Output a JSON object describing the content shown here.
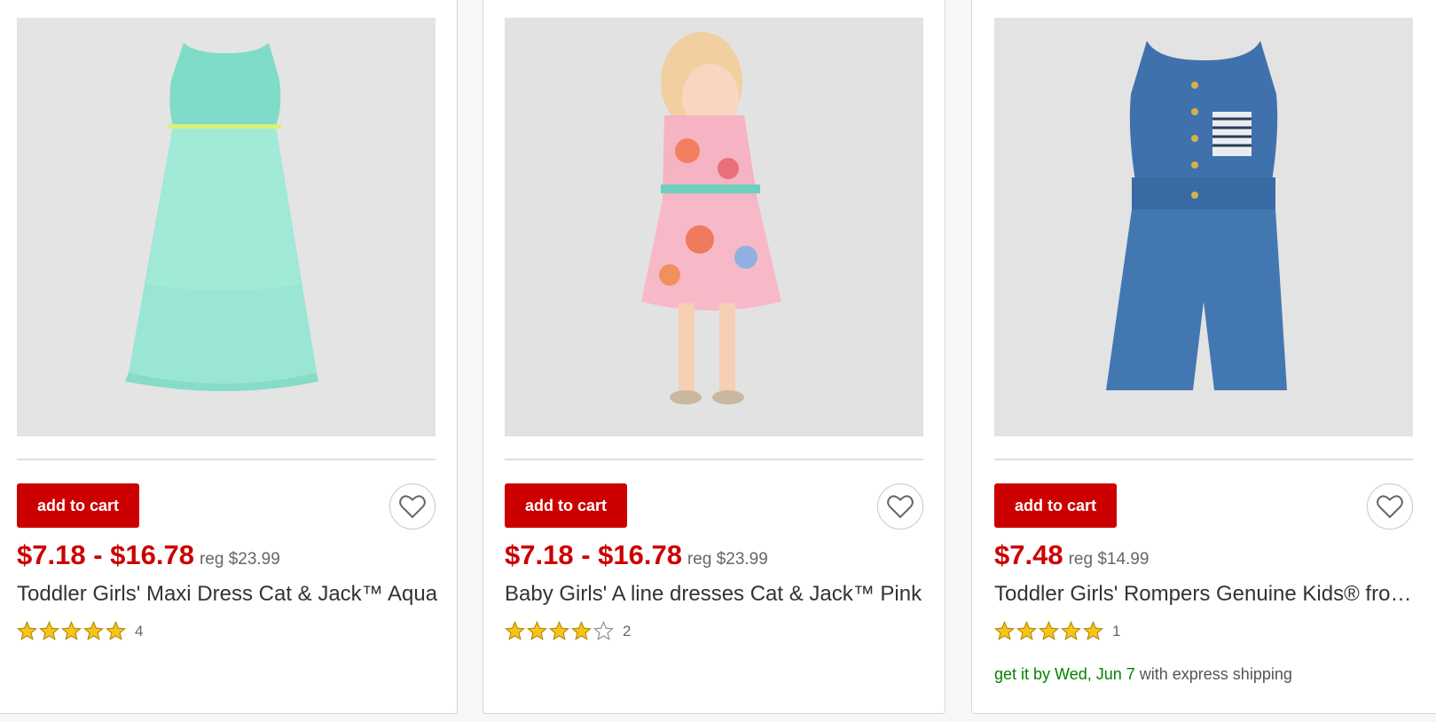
{
  "colors": {
    "accent_red": "#cc0000",
    "shipping_green": "#008300",
    "star_gold": "#f5c518"
  },
  "products": [
    {
      "image": "mint-tulle-maxi-dress-photo",
      "add_to_cart_label": "add to cart",
      "favorite_icon": "heart-outline-icon",
      "price": "$7.18 - $16.78",
      "reg_price": "reg $23.99",
      "title": "Toddler Girls' Maxi Dress Cat & Jack™ Aqua",
      "rating": 5,
      "review_count": "4"
    },
    {
      "image": "floral-a-line-dress-photo",
      "add_to_cart_label": "add to cart",
      "favorite_icon": "heart-outline-icon",
      "price": "$7.18 - $16.78",
      "reg_price": "reg $23.99",
      "title": "Baby Girls' A line dresses Cat & Jack™ Pink",
      "rating": 4,
      "review_count": "2"
    },
    {
      "image": "denim-romper-photo",
      "add_to_cart_label": "add to cart",
      "favorite_icon": "heart-outline-icon",
      "price": "$7.48",
      "reg_price": "reg $14.99",
      "title": "Toddler Girls' Rompers Genuine Kids® from OshKosh",
      "rating": 5,
      "review_count": "1",
      "shipping": {
        "date_text": "get it by Wed, Jun 7",
        "suffix_text": " with express shipping"
      }
    }
  ]
}
